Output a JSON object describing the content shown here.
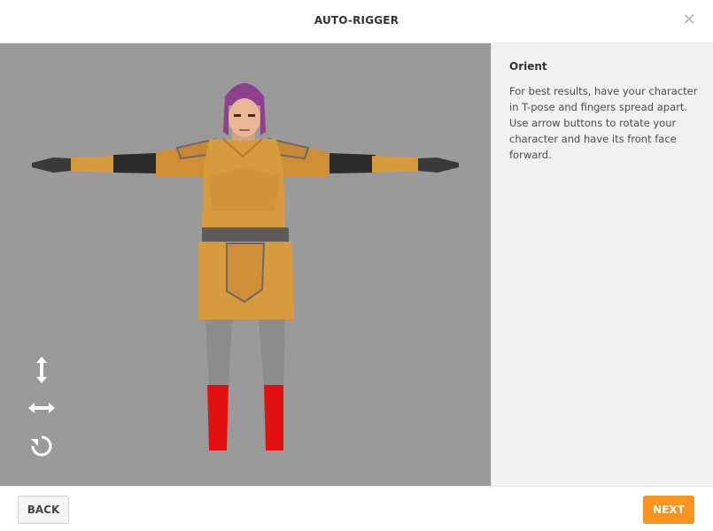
{
  "header": {
    "title": "AUTO-RIGGER",
    "close_icon": "close-icon"
  },
  "viewport": {
    "background": "#9a9a9a",
    "tools": [
      {
        "name": "vertical-arrows-icon",
        "glyph": "↕"
      },
      {
        "name": "horizontal-arrows-icon",
        "glyph": "↔"
      },
      {
        "name": "rotate-icon",
        "glyph": "↺"
      }
    ]
  },
  "side_panel": {
    "heading": "Orient",
    "text": "For best results, have your character in T-pose and fingers spread apart. Use arrow buttons to rotate your character and have its front face forward."
  },
  "footer": {
    "back_label": "BACK",
    "next_label": "NEXT"
  },
  "colors": {
    "accent": "#f7931e",
    "armor": "#d79a3c",
    "boots": "#e31010",
    "hair": "#8e3f8e",
    "skin": "#e8b896"
  }
}
